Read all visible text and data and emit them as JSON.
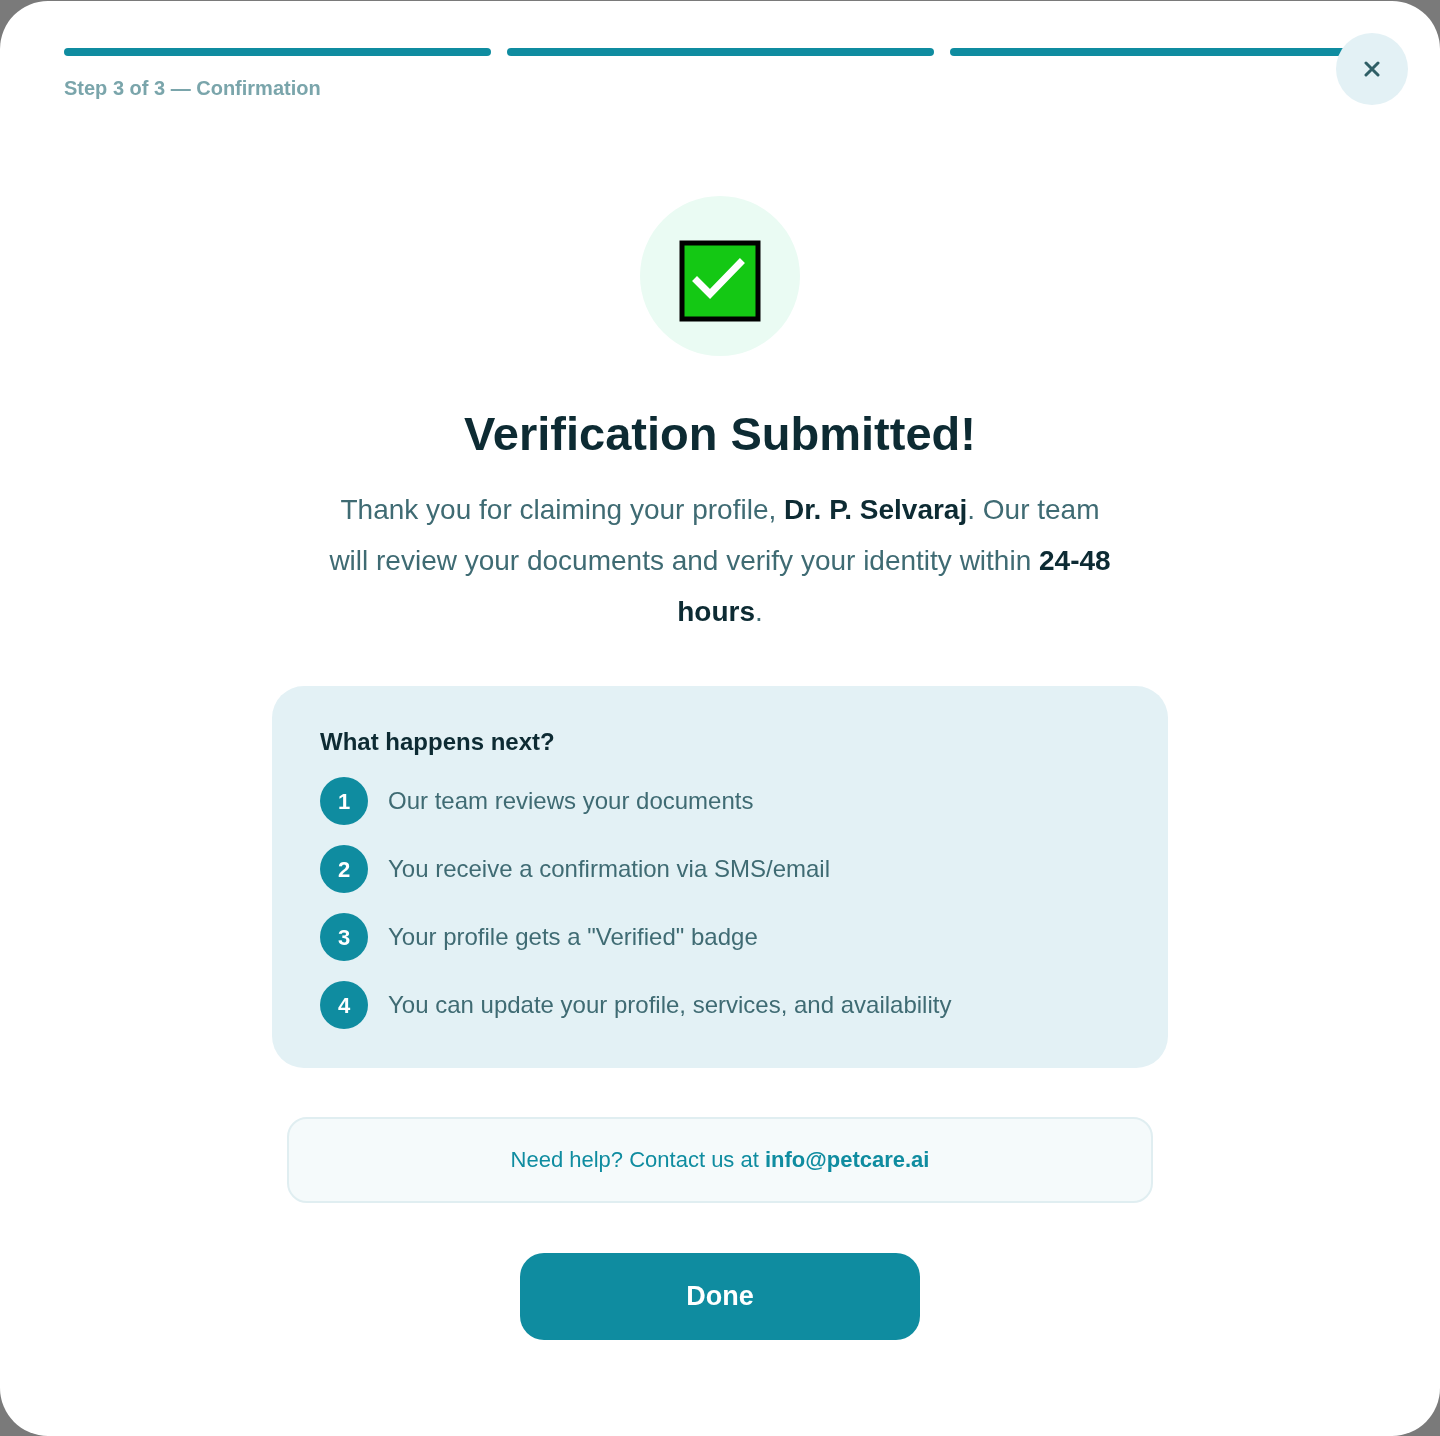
{
  "progress": {
    "steps": [
      {
        "completed": true
      },
      {
        "completed": true
      },
      {
        "completed": true
      }
    ],
    "label": "Step 3 of 3 — Confirmation"
  },
  "title": "Verification Submitted!",
  "message": "Thank you for claiming your profile, **Dr. P. Selvaraj**. Our team will review your documents and verify your identity within **24-48 hours**.",
  "next_steps": {
    "heading": "What happens next?",
    "items": [
      {
        "number": "1",
        "text": "Our team reviews your documents"
      },
      {
        "number": "2",
        "text": "You receive a confirmation via SMS/email"
      },
      {
        "number": "3",
        "text": "Your profile gets a \"Verified\" badge"
      },
      {
        "number": "4",
        "text": "You can update your profile, services, and availability"
      }
    ]
  },
  "help": {
    "text": "Need help? Contact us at",
    "email": "info@petcare.ai"
  },
  "done_button": {
    "label": "Done"
  }
}
